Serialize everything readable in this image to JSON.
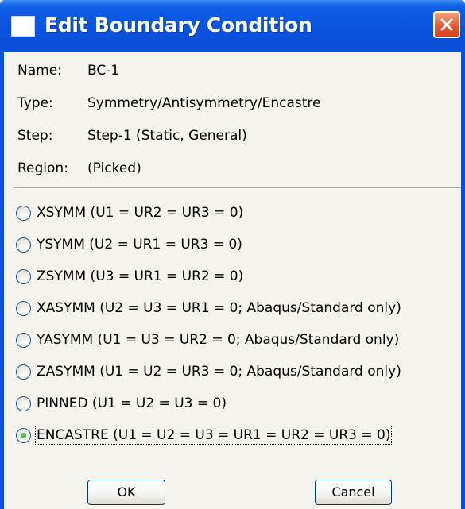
{
  "window": {
    "title": "Edit Boundary Condition",
    "title_icon": "window-icon",
    "close_icon": "close-icon"
  },
  "info": {
    "name_label": "Name:",
    "name_value": "BC-1",
    "type_label": "Type:",
    "type_value": "Symmetry/Antisymmetry/Encastre",
    "step_label": "Step:",
    "step_value": "Step-1 (Static, General)",
    "region_label": "Region:",
    "region_value": "(Picked)"
  },
  "options": [
    {
      "label": "XSYMM (U1 = UR2 = UR3 = 0)",
      "selected": false
    },
    {
      "label": "YSYMM (U2 = UR1 = UR3 = 0)",
      "selected": false
    },
    {
      "label": "ZSYMM (U3 = UR1 = UR2 = 0)",
      "selected": false
    },
    {
      "label": "XASYMM (U2 = U3 = UR1 = 0; Abaqus/Standard only)",
      "selected": false
    },
    {
      "label": "YASYMM (U1 = U3 = UR2 = 0; Abaqus/Standard only)",
      "selected": false
    },
    {
      "label": "ZASYMM (U1 = U2 = UR3 = 0; Abaqus/Standard only)",
      "selected": false
    },
    {
      "label": "PINNED (U1 = U2 = U3 = 0)",
      "selected": false
    },
    {
      "label": "ENCASTRE (U1 = U2 = U3 = UR1 = UR2 = UR3 = 0)",
      "selected": true
    }
  ],
  "buttons": {
    "ok_label": "OK",
    "cancel_label": "Cancel"
  },
  "colors": {
    "titlebar": "#0a52dd",
    "client_bg": "#f4f3ee",
    "close_button": "#e4552b",
    "radio_selected": "#21a121"
  }
}
